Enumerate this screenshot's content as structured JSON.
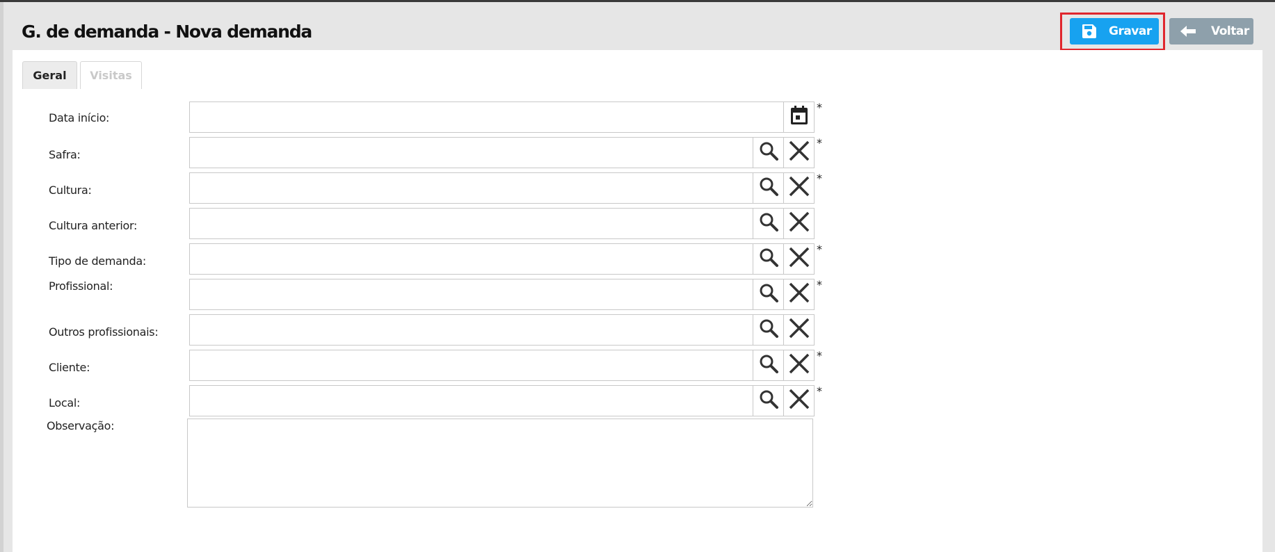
{
  "header": {
    "title": "G. de demanda - Nova demanda",
    "gravar_label": "Gravar",
    "voltar_label": "Voltar",
    "gravar_icon": "floppy-disk-icon",
    "voltar_icon": "arrow-left-icon"
  },
  "tabs": [
    {
      "label": "Geral",
      "active": true
    },
    {
      "label": "Visitas",
      "active": false
    }
  ],
  "form": {
    "fields": [
      {
        "label": "Data início:",
        "value": "",
        "type": "date",
        "required": true
      },
      {
        "label": "Safra:",
        "value": "",
        "type": "lookup",
        "required": true
      },
      {
        "label": "Cultura:",
        "value": "",
        "type": "lookup",
        "required": true
      },
      {
        "label": "Cultura anterior:",
        "value": "",
        "type": "lookup",
        "required": false
      },
      {
        "label": "Tipo de demanda:",
        "value": "",
        "type": "lookup",
        "required": true
      },
      {
        "label": "Profissional:",
        "value": "",
        "type": "lookup",
        "required": true
      },
      {
        "label": "Outros profissionais:",
        "value": "",
        "type": "lookup",
        "required": false
      },
      {
        "label": "Cliente:",
        "value": "",
        "type": "lookup",
        "required": true
      },
      {
        "label": "Local:",
        "value": "",
        "type": "lookup",
        "required": true
      }
    ],
    "required_marker": "*",
    "observacao": {
      "label": "Observação:",
      "value": ""
    }
  },
  "colors": {
    "primary": "#17a2f0",
    "secondary": "#8ea0ab",
    "highlight": "#e0262d",
    "background": "#e6e6e6"
  }
}
